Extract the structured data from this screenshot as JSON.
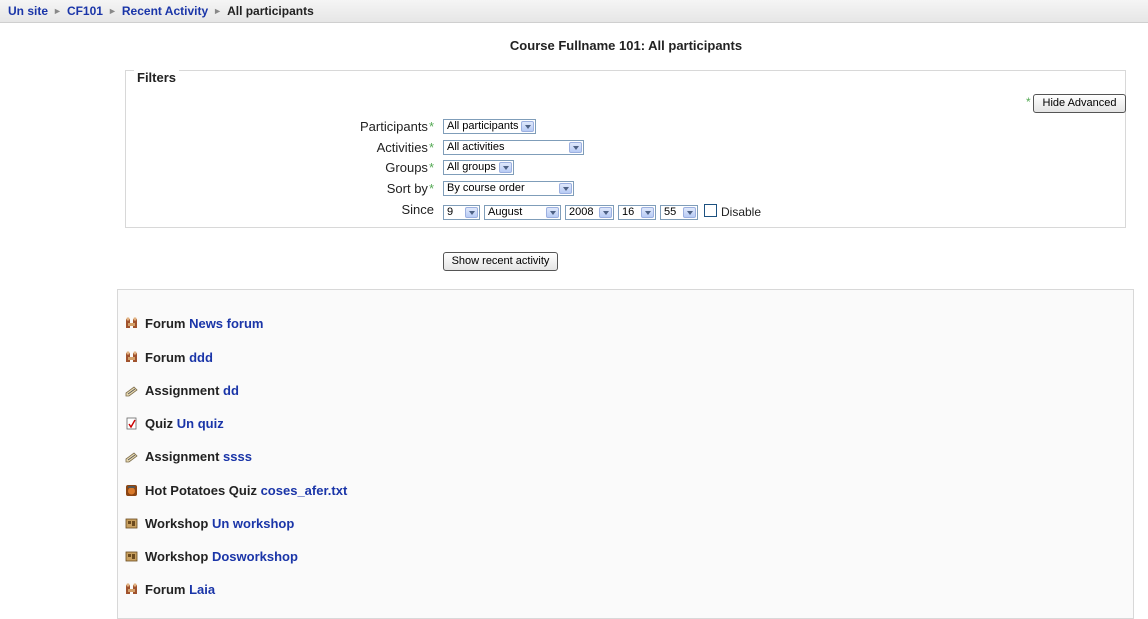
{
  "breadcrumb": {
    "items": [
      "Un site",
      "CF101",
      "Recent Activity"
    ],
    "current": "All participants"
  },
  "page_title": "Course Fullname 101: All participants",
  "filters": {
    "legend": "Filters",
    "hide_advanced": "Hide Advanced",
    "participants": {
      "label": "Participants",
      "value": "All participants"
    },
    "activities": {
      "label": "Activities",
      "value": "All activities"
    },
    "groups": {
      "label": "Groups",
      "value": "All groups"
    },
    "sort_by": {
      "label": "Sort by",
      "value": "By course order"
    },
    "since": {
      "label": "Since",
      "day": "9",
      "month": "August",
      "year": "2008",
      "hour": "16",
      "minute": "55"
    },
    "disable_label": "Disable",
    "show_button": "Show recent activity",
    "required_marker": "*"
  },
  "activities": [
    {
      "type": "Forum",
      "name": "News forum",
      "icon": "forum-icon"
    },
    {
      "type": "Forum",
      "name": "ddd",
      "icon": "forum-icon"
    },
    {
      "type": "Assignment",
      "name": "dd",
      "icon": "assignment-icon"
    },
    {
      "type": "Quiz",
      "name": "Un quiz",
      "icon": "quiz-icon"
    },
    {
      "type": "Assignment",
      "name": "ssss",
      "icon": "assignment-icon"
    },
    {
      "type": "Hot Potatoes Quiz",
      "name": "coses_afer.txt",
      "icon": "hotpot-icon"
    },
    {
      "type": "Workshop",
      "name": "Un workshop",
      "icon": "workshop-icon"
    },
    {
      "type": "Workshop",
      "name": "Dosworkshop",
      "icon": "workshop-icon"
    },
    {
      "type": "Forum",
      "name": "Laia",
      "icon": "forum-icon"
    }
  ]
}
